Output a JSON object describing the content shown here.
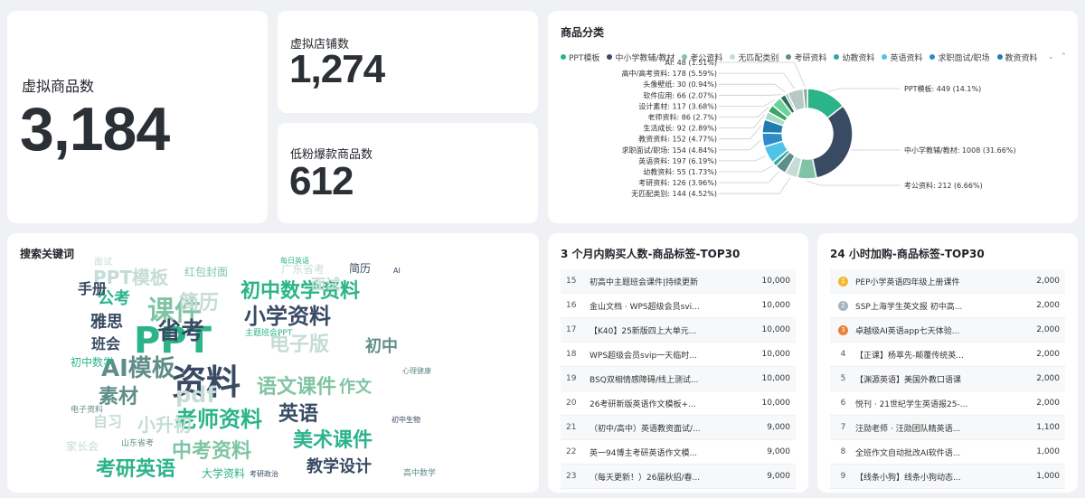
{
  "kpi": {
    "products_label": "虚拟商品数",
    "products_value": "3,184",
    "stores_label": "虚拟店铺数",
    "stores_value": "1,274",
    "hot_label": "低粉爆款商品数",
    "hot_value": "612"
  },
  "category": {
    "title": "商品分类",
    "legend": [
      {
        "label": "PPT模板",
        "color": "#2bb48a"
      },
      {
        "label": "中小学教辅/教材",
        "color": "#394b63"
      },
      {
        "label": "考公资料",
        "color": "#80c4a5"
      },
      {
        "label": "无匹配类别",
        "color": "#c5ddd6"
      },
      {
        "label": "考研资料",
        "color": "#5f8e88"
      },
      {
        "label": "幼教资料",
        "color": "#30a7a0"
      },
      {
        "label": "英语资料",
        "color": "#4fc4e6"
      },
      {
        "label": "求职面试/职场",
        "color": "#2f8cc9"
      },
      {
        "label": "教资资料",
        "color": "#1f7db0"
      }
    ],
    "chart_data": {
      "type": "pie",
      "slices": [
        {
          "label": "PPT模板",
          "value": 449,
          "pct": "14.1%",
          "color": "#2bb48a"
        },
        {
          "label": "中小学教辅/教材",
          "value": 1008,
          "pct": "31.66%",
          "color": "#394b63"
        },
        {
          "label": "考公资料",
          "value": 212,
          "pct": "6.66%",
          "color": "#80c4a5"
        },
        {
          "label": "无匹配类别",
          "value": 144,
          "pct": "4.52%",
          "color": "#c5ddd6"
        },
        {
          "label": "考研资料",
          "value": 126,
          "pct": "3.96%",
          "color": "#5f8e88"
        },
        {
          "label": "幼教资料",
          "value": 55,
          "pct": "1.73%",
          "color": "#30a7a0"
        },
        {
          "label": "英语资料",
          "value": 197,
          "pct": "6.19%",
          "color": "#4fc4e6"
        },
        {
          "label": "求职面试/职场",
          "value": 154,
          "pct": "4.84%",
          "color": "#2f8cc9"
        },
        {
          "label": "教资资料",
          "value": 152,
          "pct": "4.77%",
          "color": "#1f7db0"
        },
        {
          "label": "生活成长",
          "value": 92,
          "pct": "2.89%",
          "color": "#a8dcc4"
        },
        {
          "label": "老师资料",
          "value": 86,
          "pct": "2.7%",
          "color": "#3fa36a"
        },
        {
          "label": "设计素材",
          "value": 117,
          "pct": "3.68%",
          "color": "#6fd19a"
        },
        {
          "label": "软件应用",
          "value": 66,
          "pct": "2.07%",
          "color": "#2e6e5a"
        },
        {
          "label": "头像壁纸",
          "value": 30,
          "pct": "0.94%",
          "color": "#8ab0a8"
        },
        {
          "label": "高中/高考资料",
          "value": 178,
          "pct": "5.59%",
          "color": "#b8c9c4"
        },
        {
          "label": "AI",
          "value": 48,
          "pct": "1.51%",
          "color": "#7fa79b"
        }
      ]
    }
  },
  "search": {
    "title": "搜索关键词",
    "words": [
      {
        "text": "PPT",
        "size": 40,
        "color": "#2bb48a"
      },
      {
        "text": "资料",
        "size": 38,
        "color": "#394b63"
      },
      {
        "text": "课件",
        "size": 30,
        "color": "#80c4a5"
      },
      {
        "text": "小学资料",
        "size": 24,
        "color": "#394b63"
      },
      {
        "text": "初中数学资料",
        "size": 22,
        "color": "#2bb48a"
      },
      {
        "text": "老师资料",
        "size": 24,
        "color": "#2bb48a"
      },
      {
        "text": "AI模板",
        "size": 26,
        "color": "#5f8e88"
      },
      {
        "text": "省考",
        "size": 26,
        "color": "#394b63"
      },
      {
        "text": "电子版",
        "size": 22,
        "color": "#c5ddd6"
      },
      {
        "text": "语文课件",
        "size": 22,
        "color": "#80c4a5"
      },
      {
        "text": "pdf",
        "size": 24,
        "color": "#c5ddd6"
      },
      {
        "text": "素材",
        "size": 22,
        "color": "#5f8e88"
      },
      {
        "text": "英语",
        "size": 22,
        "color": "#394b63"
      },
      {
        "text": "作文",
        "size": 18,
        "color": "#80c4a5"
      },
      {
        "text": "中考资料",
        "size": 22,
        "color": "#80c4a5"
      },
      {
        "text": "美术课件",
        "size": 22,
        "color": "#2bb48a"
      },
      {
        "text": "考研英语",
        "size": 22,
        "color": "#2bb48a"
      },
      {
        "text": "教学设计",
        "size": 18,
        "color": "#394b63"
      },
      {
        "text": "小升初",
        "size": 20,
        "color": "#c5ddd6"
      },
      {
        "text": "简历",
        "size": 22,
        "color": "#c5ddd6"
      },
      {
        "text": "PPT模板",
        "size": 20,
        "color": "#c5ddd6"
      },
      {
        "text": "雅思",
        "size": 18,
        "color": "#394b63"
      },
      {
        "text": "公考",
        "size": 18,
        "color": "#2bb48a"
      },
      {
        "text": "手册",
        "size": 16,
        "color": "#394b63"
      },
      {
        "text": "班会",
        "size": 16,
        "color": "#394b63"
      },
      {
        "text": "自习",
        "size": 16,
        "color": "#c5ddd6"
      },
      {
        "text": "初中",
        "size": 18,
        "color": "#5f8e88"
      },
      {
        "text": "面试",
        "size": 16,
        "color": "#c5ddd6"
      },
      {
        "text": "初中数学",
        "size": 12,
        "color": "#2bb48a"
      },
      {
        "text": "大学资料",
        "size": 12,
        "color": "#2bb48a"
      },
      {
        "text": "家长会",
        "size": 12,
        "color": "#c5ddd6"
      },
      {
        "text": "红包封面",
        "size": 12,
        "color": "#80c4a5"
      },
      {
        "text": "广东省考",
        "size": 12,
        "color": "#c5ddd6"
      },
      {
        "text": "简历",
        "size": 12,
        "color": "#394b63"
      },
      {
        "text": "每日英语",
        "size": 8,
        "color": "#2bb48a"
      },
      {
        "text": "主题班会PPT",
        "size": 9,
        "color": "#2bb48a"
      },
      {
        "text": "山东省考",
        "size": 9,
        "color": "#5f8e88"
      },
      {
        "text": "高中数学",
        "size": 9,
        "color": "#5f8e88"
      },
      {
        "text": "考研政治",
        "size": 8,
        "color": "#394b63"
      },
      {
        "text": "电子资料",
        "size": 9,
        "color": "#5f8e88"
      },
      {
        "text": "心理健康",
        "size": 8,
        "color": "#5f8e88"
      },
      {
        "text": "初中生物",
        "size": 8,
        "color": "#394b63"
      },
      {
        "text": "AI",
        "size": 8,
        "color": "#394b63"
      },
      {
        "text": "面试",
        "size": 10,
        "color": "#c5ddd6"
      }
    ]
  },
  "buyers": {
    "title": "3 个月内购买人数-商品标签-TOP30",
    "rows": [
      {
        "rank": "15",
        "name": "初高中主题班会课件|持续更新",
        "value": "10,000"
      },
      {
        "rank": "16",
        "name": "金山文档 · WPS超级会员svi...",
        "value": "10,000"
      },
      {
        "rank": "17",
        "name": "【K40】25新版四上大单元...",
        "value": "10,000"
      },
      {
        "rank": "18",
        "name": "WPS超级会员svip一天临时...",
        "value": "10,000"
      },
      {
        "rank": "19",
        "name": "BSQ双相情感障碍/线上测试...",
        "value": "10,000"
      },
      {
        "rank": "20",
        "name": "26考研新版英语作文模板+...",
        "value": "10,000"
      },
      {
        "rank": "21",
        "name": "（初中/高中）英语教资面试/...",
        "value": "9,000"
      },
      {
        "rank": "22",
        "name": "英一94博主考研英语作文模...",
        "value": "9,000"
      },
      {
        "rank": "23",
        "name": "（每天更新！）26届秋招/春...",
        "value": "9,000"
      }
    ]
  },
  "purchases24": {
    "title": "24 小时加购-商品标签-TOP30",
    "rows": [
      {
        "rank": "1",
        "name": "PEP小学英语四年级上册课件",
        "value": "2,000",
        "medal": "#f5b82e"
      },
      {
        "rank": "2",
        "name": "SSP上海学生英文报 初中高...",
        "value": "2,000",
        "medal": "#a9b4c2"
      },
      {
        "rank": "3",
        "name": "卓越级AI英语app七天体验...",
        "value": "2,000",
        "medal": "#e9813a"
      },
      {
        "rank": "4",
        "name": "【正课】杨萃先-颠覆传统英...",
        "value": "2,000"
      },
      {
        "rank": "5",
        "name": "【渊源英语】美国外教口语课",
        "value": "2,000"
      },
      {
        "rank": "6",
        "name": "悦刊 · 21世纪学生英语报25-...",
        "value": "2,000"
      },
      {
        "rank": "7",
        "name": "汪勋老师 · 汪勋团队精英语...",
        "value": "1,100"
      },
      {
        "rank": "8",
        "name": "全班作文自动批改AI软件语...",
        "value": "1,000"
      },
      {
        "rank": "9",
        "name": "【线条小狗】线条小狗动态...",
        "value": "1,000"
      }
    ]
  }
}
